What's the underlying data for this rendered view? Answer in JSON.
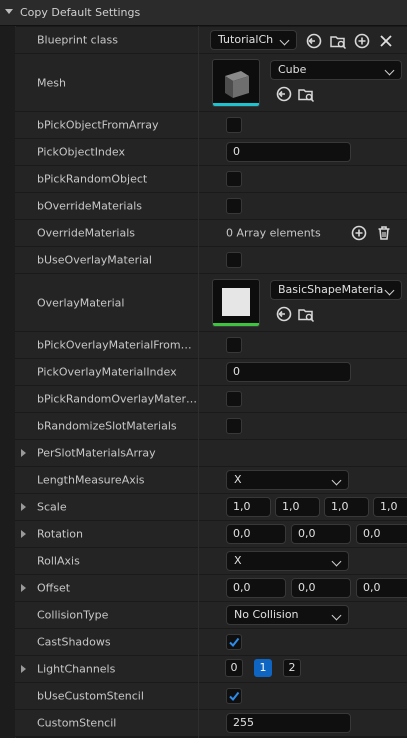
{
  "section": {
    "title": "Copy Default Settings"
  },
  "rows": {
    "blueprint_class": {
      "label": "Blueprint class",
      "value": "TutorialCh"
    },
    "mesh": {
      "label": "Mesh",
      "value": "Cube"
    },
    "pick_object_from_array": {
      "label": "bPickObjectFromArray",
      "checked": false
    },
    "pick_object_index": {
      "label": "PickObjectIndex",
      "value": "0"
    },
    "pick_random_object": {
      "label": "bPickRandomObject",
      "checked": false
    },
    "override_materials_flag": {
      "label": "bOverrideMaterials",
      "checked": false
    },
    "override_materials": {
      "label": "OverrideMaterials",
      "value": "0 Array elements"
    },
    "use_overlay_material": {
      "label": "bUseOverlayMaterial",
      "checked": false
    },
    "overlay_material": {
      "label": "OverlayMaterial",
      "value": "BasicShapeMateria"
    },
    "pick_overlay_from_array": {
      "label": "bPickOverlayMaterialFromArr...",
      "checked": false
    },
    "pick_overlay_index": {
      "label": "PickOverlayMaterialIndex",
      "value": "0"
    },
    "pick_random_overlay": {
      "label": "bPickRandomOverlayMaterial",
      "checked": false
    },
    "randomize_slot": {
      "label": "bRandomizeSlotMaterials",
      "checked": false
    },
    "per_slot": {
      "label": "PerSlotMaterialsArray"
    },
    "length_axis": {
      "label": "LengthMeasureAxis",
      "value": "X"
    },
    "scale": {
      "label": "Scale",
      "values": [
        "1,0",
        "1,0",
        "1,0",
        "1,0"
      ]
    },
    "rotation": {
      "label": "Rotation",
      "values": [
        "0,0",
        "0,0",
        "0,0"
      ]
    },
    "roll_axis": {
      "label": "RollAxis",
      "value": "X"
    },
    "offset": {
      "label": "Offset",
      "values": [
        "0,0",
        "0,0",
        "0,0"
      ]
    },
    "collision": {
      "label": "CollisionType",
      "value": "No Collision"
    },
    "cast_shadows": {
      "label": "CastShadows",
      "checked": true
    },
    "light_channels": {
      "label": "LightChannels",
      "channels": [
        "0",
        "1",
        "2"
      ],
      "selected": "1"
    },
    "use_custom_stencil": {
      "label": "bUseCustomStencil",
      "checked": true
    },
    "custom_stencil": {
      "label": "CustomStencil",
      "value": "255"
    }
  },
  "colors": {
    "accent": "#0e66c2",
    "check": "#2d8ceb",
    "thumb_bar_mesh": "#1fc3d0",
    "thumb_bar_material": "#3fc43f"
  }
}
